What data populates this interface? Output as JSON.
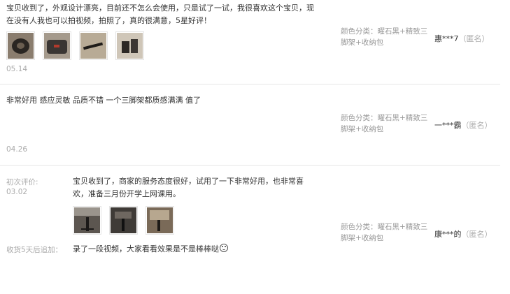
{
  "reviews": [
    {
      "text": "宝贝收到了，外观设计漂亮，目前还不怎么会使用，只是试了一试，我很喜欢这个宝贝，现在没有人我也可以拍视频，拍照了，真的很满意，5星好评！",
      "date": "05.14",
      "sku": "颜色分类：曜石黑+精致三脚架+收纳包",
      "user": "惠***7",
      "anon": "（匿名）",
      "photos": [
        "photo-1",
        "photo-2",
        "photo-3",
        "photo-4"
      ]
    },
    {
      "text": "非常好用 感应灵敏 品质不错 一个三脚架都质感满满 值了",
      "date": "04.26",
      "sku": "颜色分类：曜石黑+精致三脚架+收纳包",
      "user": "一***霸",
      "anon": "（匿名）"
    },
    {
      "initial_label": "初次评价:",
      "date": "03.02",
      "text": "宝贝收到了，商家的服务态度很好，试用了一下非常好用，也非常喜欢，准备三月份开学上网课用。",
      "photos": [
        "photo-1",
        "photo-2",
        "photo-3"
      ],
      "sku": "颜色分类：曜石黑+精致三脚架+收纳包",
      "user": "康***的",
      "anon": "（匿名）",
      "followup_label": "收货5天后追加：",
      "followup_text": "录了一段视频，大家看看效果是不是棒棒哒"
    }
  ]
}
